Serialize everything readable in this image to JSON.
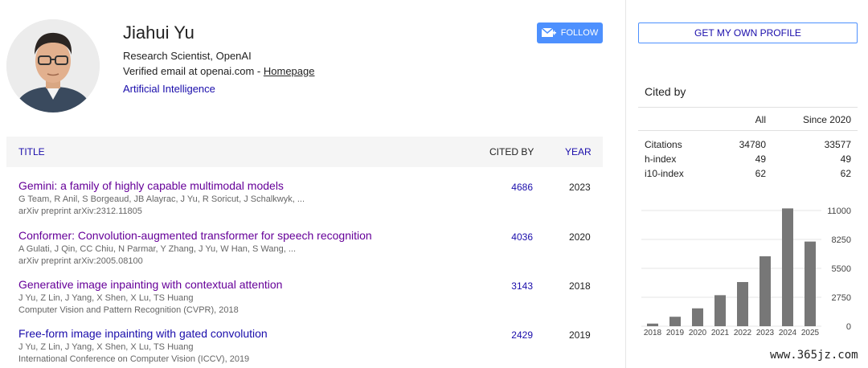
{
  "profile": {
    "name": "Jiahui Yu",
    "affiliation": "Research Scientist, OpenAI",
    "email_text": "Verified email at openai.com - ",
    "homepage_label": "Homepage",
    "interest": "Artificial Intelligence",
    "follow_label": "FOLLOW"
  },
  "table": {
    "col_title": "TITLE",
    "col_cited": "CITED BY",
    "col_year": "YEAR",
    "rows": [
      {
        "title": "Gemini: a family of highly capable multimodal models",
        "authors": "G Team, R Anil, S Borgeaud, JB Alayrac, J Yu, R Soricut, J Schalkwyk, ...",
        "venue": "arXiv preprint arXiv:2312.11805",
        "cited": "4686",
        "year": "2023"
      },
      {
        "title": "Conformer: Convolution-augmented transformer for speech recognition",
        "authors": "A Gulati, J Qin, CC Chiu, N Parmar, Y Zhang, J Yu, W Han, S Wang, ...",
        "venue": "arXiv preprint arXiv:2005.08100",
        "cited": "4036",
        "year": "2020"
      },
      {
        "title": "Generative image inpainting with contextual attention",
        "authors": "J Yu, Z Lin, J Yang, X Shen, X Lu, TS Huang",
        "venue": "Computer Vision and Pattern Recognition (CVPR), 2018",
        "cited": "3143",
        "year": "2018"
      },
      {
        "title": "Free-form image inpainting with gated convolution",
        "authors": "J Yu, Z Lin, J Yang, X Shen, X Lu, TS Huang",
        "venue": "International Conference on Computer Vision (ICCV), 2019",
        "cited": "2429",
        "year": "2019"
      }
    ]
  },
  "sidebar": {
    "profile_button": "GET MY OWN PROFILE",
    "cited_by_title": "Cited by",
    "col_all": "All",
    "col_since": "Since 2020",
    "stats": [
      {
        "label": "Citations",
        "all": "34780",
        "since": "33577"
      },
      {
        "label": "h-index",
        "all": "49",
        "since": "49"
      },
      {
        "label": "i10-index",
        "all": "62",
        "since": "62"
      }
    ]
  },
  "chart_data": {
    "type": "bar",
    "categories": [
      "2018",
      "2019",
      "2020",
      "2021",
      "2022",
      "2023",
      "2024",
      "2025"
    ],
    "values": [
      250,
      900,
      1700,
      2950,
      4200,
      6650,
      11200,
      8050
    ],
    "yticks": [
      "11000",
      "8250",
      "5500",
      "2750",
      "0"
    ],
    "ylim": [
      0,
      11000
    ],
    "bar_color": "#777777"
  },
  "watermark": "www.365jz.com",
  "colors": {
    "link": "#1a0dab",
    "visited": "#660099",
    "button": "#4d90fe"
  }
}
